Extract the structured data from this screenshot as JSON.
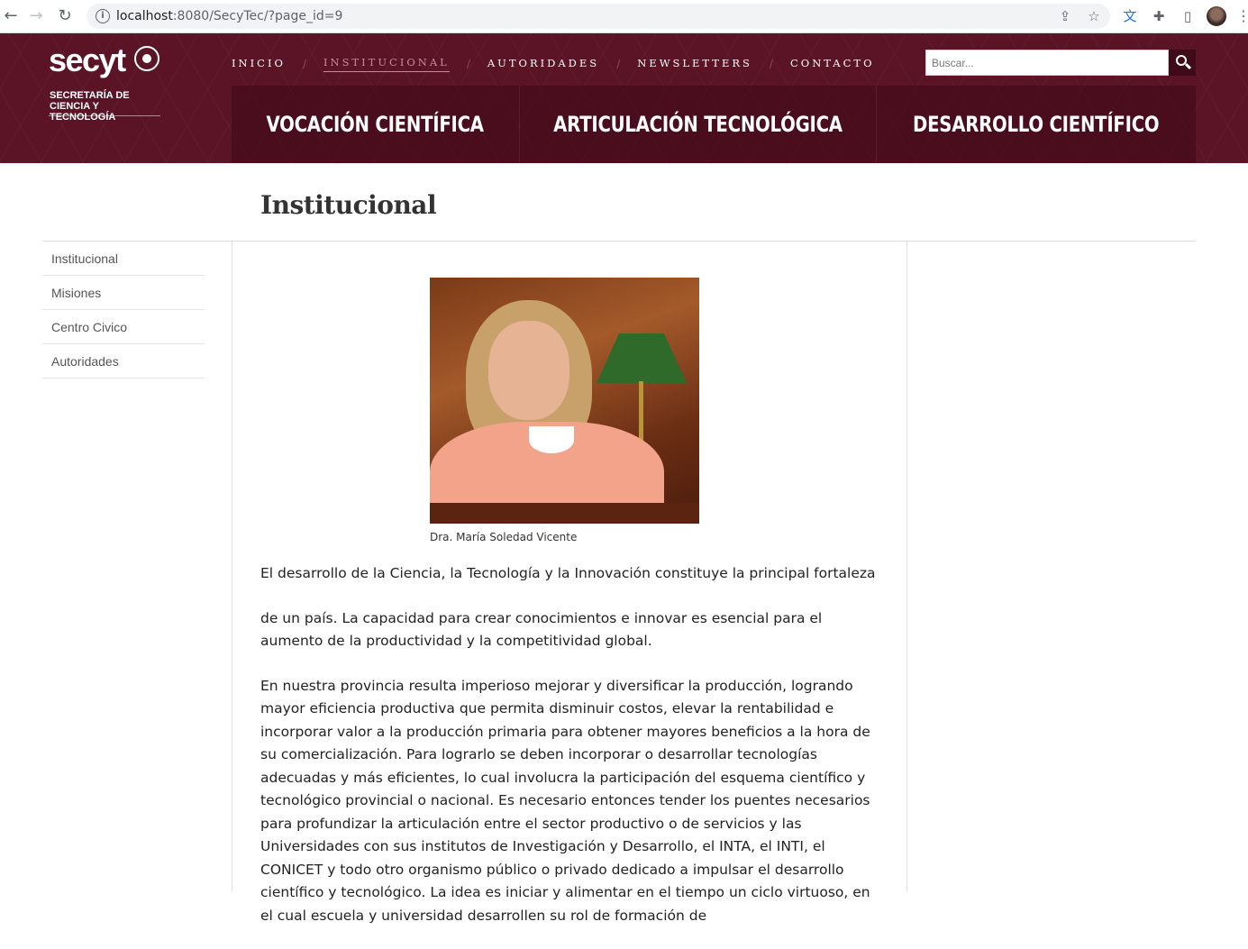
{
  "browser": {
    "url_host": "localhost",
    "url_path": ":8080/SecyTec/?page_id=9"
  },
  "header": {
    "logo_text": "secyt",
    "logo_subtitle_line1": "SECRETARÍA DE",
    "logo_subtitle_line2": "CIENCIA Y TECNOLOGÍA",
    "nav": [
      {
        "label": "INICIO",
        "active": false
      },
      {
        "label": "INSTITUCIONAL",
        "active": true
      },
      {
        "label": "AUTORIDADES",
        "active": false
      },
      {
        "label": "NEWSLETTERS",
        "active": false
      },
      {
        "label": "CONTACTO",
        "active": false
      }
    ],
    "nav_separator": "/",
    "search_placeholder": "Buscar...",
    "big_nav": [
      {
        "label": "VOCACIÓN CIENTÍFICA"
      },
      {
        "label": "ARTICULACIÓN TECNOLÓGICA"
      },
      {
        "label": "DESARROLLO CIENTÍFICO"
      }
    ]
  },
  "page": {
    "title": "Institucional",
    "sidebar": [
      {
        "label": "Institucional"
      },
      {
        "label": "Misiones"
      },
      {
        "label": "Centro Civico"
      },
      {
        "label": "Autoridades"
      }
    ],
    "image_caption": "Dra. María Soledad Vicente",
    "paragraphs": [
      "El desarrollo de la Ciencia, la Tecnología y la Innovación constituye la principal fortaleza",
      "de un país. La capacidad para crear conocimientos e innovar es esencial para el aumento de la productividad y la competitividad global.",
      "En nuestra provincia resulta imperioso mejorar y diversificar la producción, logrando mayor eficiencia productiva que permita disminuir costos, elevar la rentabilidad e incorporar valor a la producción primaria para obtener mayores beneficios a la hora de su comercialización. Para lograrlo se deben incorporar o desarrollar tecnologías adecuadas y más eficientes, lo cual involucra la participación del esquema científico y tecnológico provincial o nacional. Es necesario entonces tender los puentes necesarios para profundizar la articulación entre el sector productivo o de servicios y las Universidades con sus institutos de Investigación y Desarrollo, el INTA, el INTI, el CONICET y todo otro organismo público o privado dedicado a impulsar el desarrollo científico y tecnológico. La idea es iniciar y alimentar en el tiempo un ciclo virtuoso, en el cual escuela y universidad desarrollen su rol de formación de"
    ]
  },
  "colors": {
    "header_bg": "#5a1426",
    "active_nav": "#c98a98",
    "search_button": "#3f0b19"
  },
  "icons": [
    "back-icon",
    "forward-icon",
    "reload-icon",
    "info-icon",
    "share-icon",
    "bookmark-star-icon",
    "translate-icon",
    "extensions-icon",
    "side-panel-icon",
    "profile-avatar",
    "menu-dots-icon",
    "search-icon",
    "seal-icon"
  ]
}
